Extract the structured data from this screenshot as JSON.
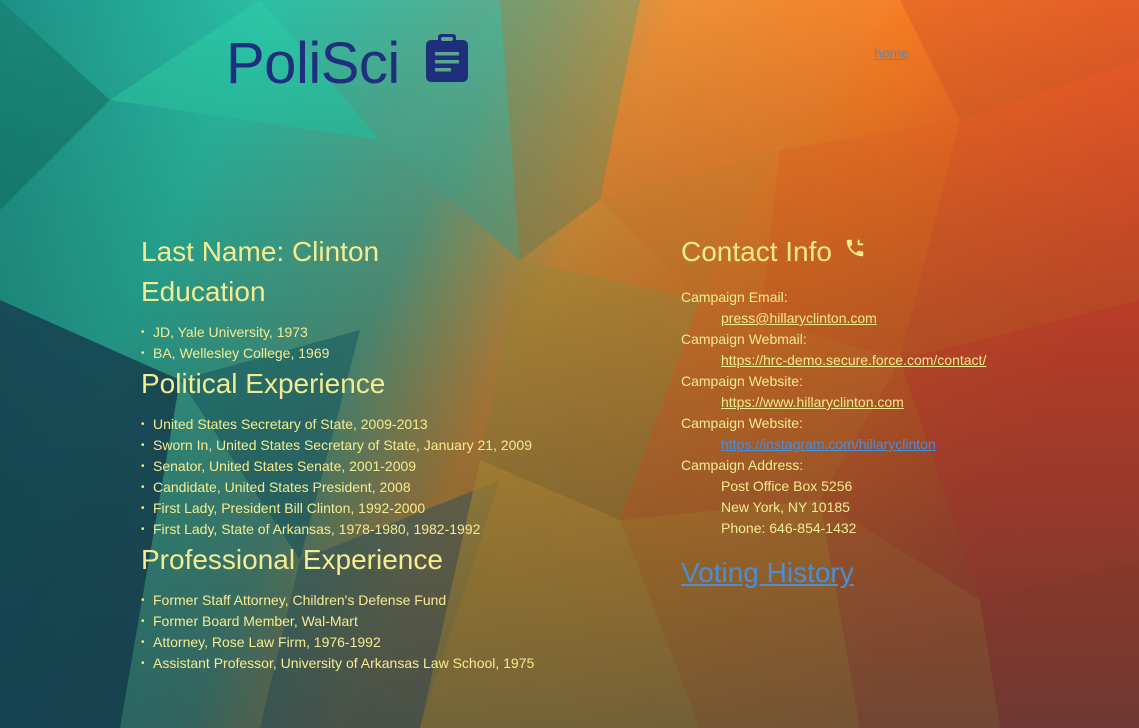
{
  "brand": {
    "title": "PoliSci",
    "icon": "clipboard-icon"
  },
  "nav": {
    "home_label": "home"
  },
  "profile": {
    "last_name_label": "Last Name: Clinton"
  },
  "education": {
    "heading": "Education",
    "items": [
      "JD, Yale University, 1973",
      "BA, Wellesley College, 1969"
    ]
  },
  "political": {
    "heading": "Political Experience",
    "items": [
      "United States Secretary of State, 2009-2013",
      "Sworn In, United States Secretary of State, January 21, 2009",
      "Senator, United States Senate, 2001-2009",
      "Candidate, United States President, 2008",
      "First Lady, President Bill Clinton, 1992-2000",
      "First Lady, State of Arkansas, 1978-1980, 1982-1992"
    ]
  },
  "professional": {
    "heading": "Professional Experience",
    "items": [
      "Former Staff Attorney, Children's Defense Fund",
      "Former Board Member, Wal-Mart",
      "Attorney, Rose Law Firm, 1976-1992",
      "Assistant Professor, University of Arkansas Law School, 1975"
    ]
  },
  "contact": {
    "heading": "Contact Info",
    "icon": "phone-icon",
    "email_label": "Campaign Email:",
    "email": "press@hillaryclinton.com",
    "webmail_label": "Campaign Webmail:",
    "webmail": "https://hrc-demo.secure.force.com/contact/",
    "website_label": "Campaign Website:",
    "website": "https://www.hillaryclinton.com",
    "website2_label": "Campaign Website:",
    "website2": "https://instagram.com/hillaryclinton",
    "address_label": "Campaign Address:",
    "address_line1": "Post Office Box 5256",
    "address_line2": "New York, NY 10185",
    "phone": "Phone: 646-854-1432"
  },
  "voting": {
    "label": "Voting History"
  },
  "colors": {
    "accent_text": "#f5eb8f",
    "link_blue": "#4a8ed6",
    "brand_navy": "#1f2f7e"
  }
}
